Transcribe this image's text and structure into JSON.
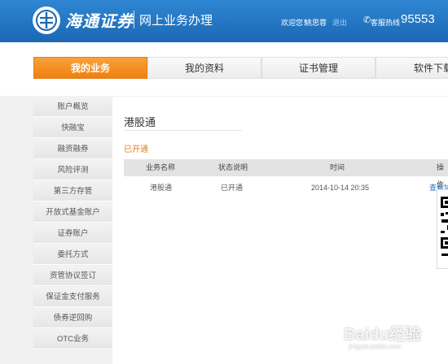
{
  "header": {
    "brand": "海通证券",
    "subtitle": "网上业务办理",
    "welcome": "欢迎您！",
    "username": "姚思蓉",
    "logout": "退出",
    "hotline_label": "客服热线",
    "hotline_number": "95553"
  },
  "nav": {
    "tabs": [
      {
        "label": "我的业务",
        "active": true
      },
      {
        "label": "我的资料",
        "active": false
      },
      {
        "label": "证书管理",
        "active": false
      },
      {
        "label": "软件下载",
        "active": false
      }
    ]
  },
  "sidebar": {
    "items": [
      {
        "label": "账户概览"
      },
      {
        "label": "快融宝"
      },
      {
        "label": "融资融券"
      },
      {
        "label": "风险评测"
      },
      {
        "label": "第三方存管"
      },
      {
        "label": "开放式基金账户"
      },
      {
        "label": "证券账户"
      },
      {
        "label": "委托方式"
      },
      {
        "label": "资管协议签订"
      },
      {
        "label": "保证金支付服务"
      },
      {
        "label": "债券逆回购"
      },
      {
        "label": "OTC业务"
      }
    ]
  },
  "main": {
    "title": "港股通",
    "status_heading": "已开通",
    "table": {
      "headers": [
        "业务名称",
        "状态说明",
        "时间",
        "操作"
      ],
      "rows": [
        {
          "name": "港股通",
          "status": "已开通",
          "time": "2014-10-14 20:35",
          "action": "查看协议"
        }
      ]
    }
  },
  "watermark": {
    "text": "Baidu经验",
    "url": "jingyan.baidu.com"
  },
  "colors": {
    "header_blue": "#1f72c0",
    "accent_orange": "#f08010",
    "link_blue": "#2a6fb8"
  }
}
